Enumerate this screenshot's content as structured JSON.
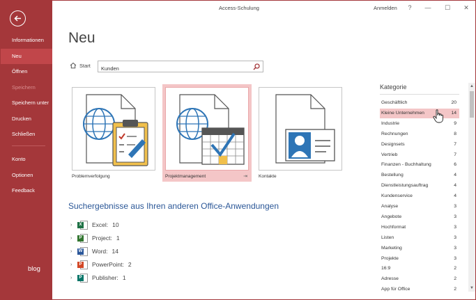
{
  "window": {
    "title": "Access-Schulung",
    "signin": "Anmelden",
    "help": "?",
    "minimize": "—",
    "maximize": "☐",
    "close": "✕"
  },
  "sidebar": {
    "items": [
      {
        "label": "Informationen"
      },
      {
        "label": "Neu"
      },
      {
        "label": "Öffnen"
      },
      {
        "label": "Speichern"
      },
      {
        "label": "Speichern unter"
      },
      {
        "label": "Drucken"
      },
      {
        "label": "Schließen"
      },
      {
        "label": "Konto"
      },
      {
        "label": "Optionen"
      },
      {
        "label": "Feedback"
      }
    ],
    "brand": "blog"
  },
  "main": {
    "title": "Neu",
    "start_label": "Start",
    "search_value": "Kunden",
    "templates": [
      {
        "label": "Problemverfolgung"
      },
      {
        "label": "Projektmanagement"
      },
      {
        "label": "Kontakte"
      }
    ],
    "results_title": "Suchergebnisse aus Ihren anderen Office-Anwendungen",
    "results": [
      {
        "badge": "X",
        "app": "Excel:",
        "count": "10",
        "color": "#1e7145"
      },
      {
        "badge": "P",
        "app": "Project:",
        "count": "1",
        "color": "#31752f"
      },
      {
        "badge": "W",
        "app": "Word:",
        "count": "14",
        "color": "#2b579a"
      },
      {
        "badge": "P",
        "app": "PowerPoint:",
        "count": "2",
        "color": "#d24726"
      },
      {
        "badge": "P",
        "app": "Publisher:",
        "count": "1",
        "color": "#077568"
      }
    ]
  },
  "category": {
    "title": "Kategorie",
    "items": [
      {
        "name": "Geschäftlich",
        "count": "20"
      },
      {
        "name": "Kleine Unternehmen",
        "count": "14"
      },
      {
        "name": "Industrie",
        "count": "9"
      },
      {
        "name": "Rechnungen",
        "count": "8"
      },
      {
        "name": "Designsets",
        "count": "7"
      },
      {
        "name": "Vertrieb",
        "count": "7"
      },
      {
        "name": "Finanzen - Buchhaltung",
        "count": "6"
      },
      {
        "name": "Bestellung",
        "count": "4"
      },
      {
        "name": "Dienstleistungsauftrag",
        "count": "4"
      },
      {
        "name": "Kundenservice",
        "count": "4"
      },
      {
        "name": "Analyse",
        "count": "3"
      },
      {
        "name": "Angebote",
        "count": "3"
      },
      {
        "name": "Hochformat",
        "count": "3"
      },
      {
        "name": "Listen",
        "count": "3"
      },
      {
        "name": "Marketing",
        "count": "3"
      },
      {
        "name": "Projekte",
        "count": "3"
      },
      {
        "name": "16:9",
        "count": "2"
      },
      {
        "name": "Adresse",
        "count": "2"
      },
      {
        "name": "App für Office",
        "count": "2"
      }
    ]
  },
  "colors": {
    "brand": "#a4373a",
    "selected": "#f4c6c7",
    "link": "#2b5797"
  }
}
